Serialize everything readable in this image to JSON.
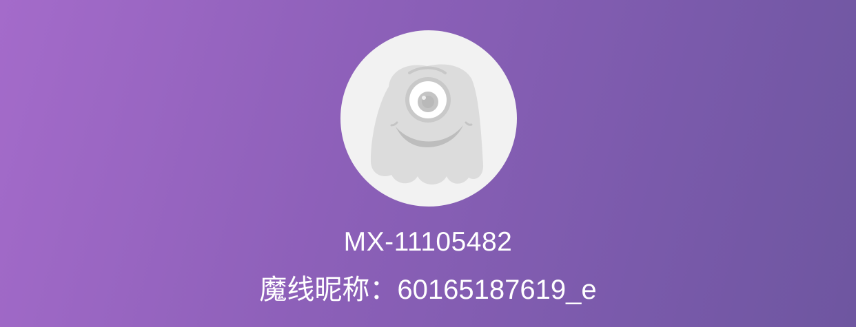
{
  "profile": {
    "avatar_icon": "default-monster-avatar-icon",
    "user_id": "MX-11105482",
    "nickname_label": "魔线昵称：",
    "nickname_value": "60165187619_e"
  },
  "colors": {
    "background_gradient_start": "#a46bca",
    "background_gradient_end": "#6e56a0",
    "avatar_background": "#f2f2f2",
    "avatar_figure": "#d9d9d9",
    "text": "#ffffff"
  }
}
